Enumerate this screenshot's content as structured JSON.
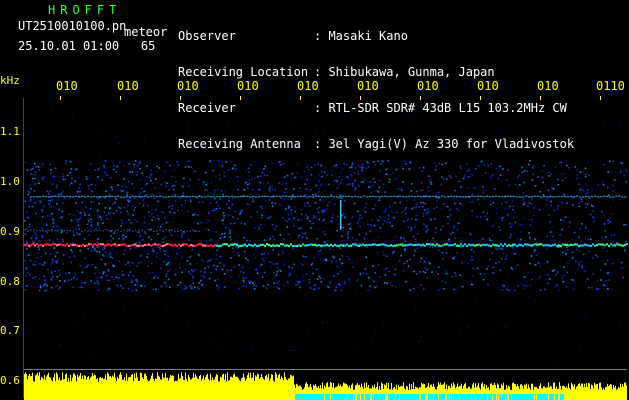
{
  "app": {
    "name": "HROFFT"
  },
  "file": {
    "name": "UT2510010100.pn",
    "suffix": "meteor"
  },
  "timestamp": {
    "datetime": "25.10.01 01:00",
    "value": "65"
  },
  "info": [
    {
      "key": "Observer",
      "value": ": Masaki Kano"
    },
    {
      "key": "Receiving Location",
      "value": ": Shibukawa, Gunma, Japan"
    },
    {
      "key": "Receiver",
      "value": ": RTL-SDR SDR# 43dB L15 103.2MHz CW"
    },
    {
      "key": "Receiving Antenna",
      "value": ": 3el Yagi(V) Az 330 for Vladivostok"
    }
  ],
  "time_axis": {
    "labels": [
      "010",
      "010",
      "010",
      "010",
      "010",
      "010",
      "010",
      "010",
      "010",
      "0110"
    ]
  },
  "freq_axis": {
    "unit": "kHz",
    "labels": [
      "1.1",
      "1.0",
      "0.9",
      "0.8",
      "0.7",
      "0.6"
    ]
  },
  "colors": {
    "header_green": "#2fff2f",
    "axis_yellow": "#ffff00",
    "signal_red": "#ff2040",
    "noise_blue": "#1030ff",
    "histogram_yellow": "#ffff00",
    "histogram_cyan": "#00ffff"
  }
}
